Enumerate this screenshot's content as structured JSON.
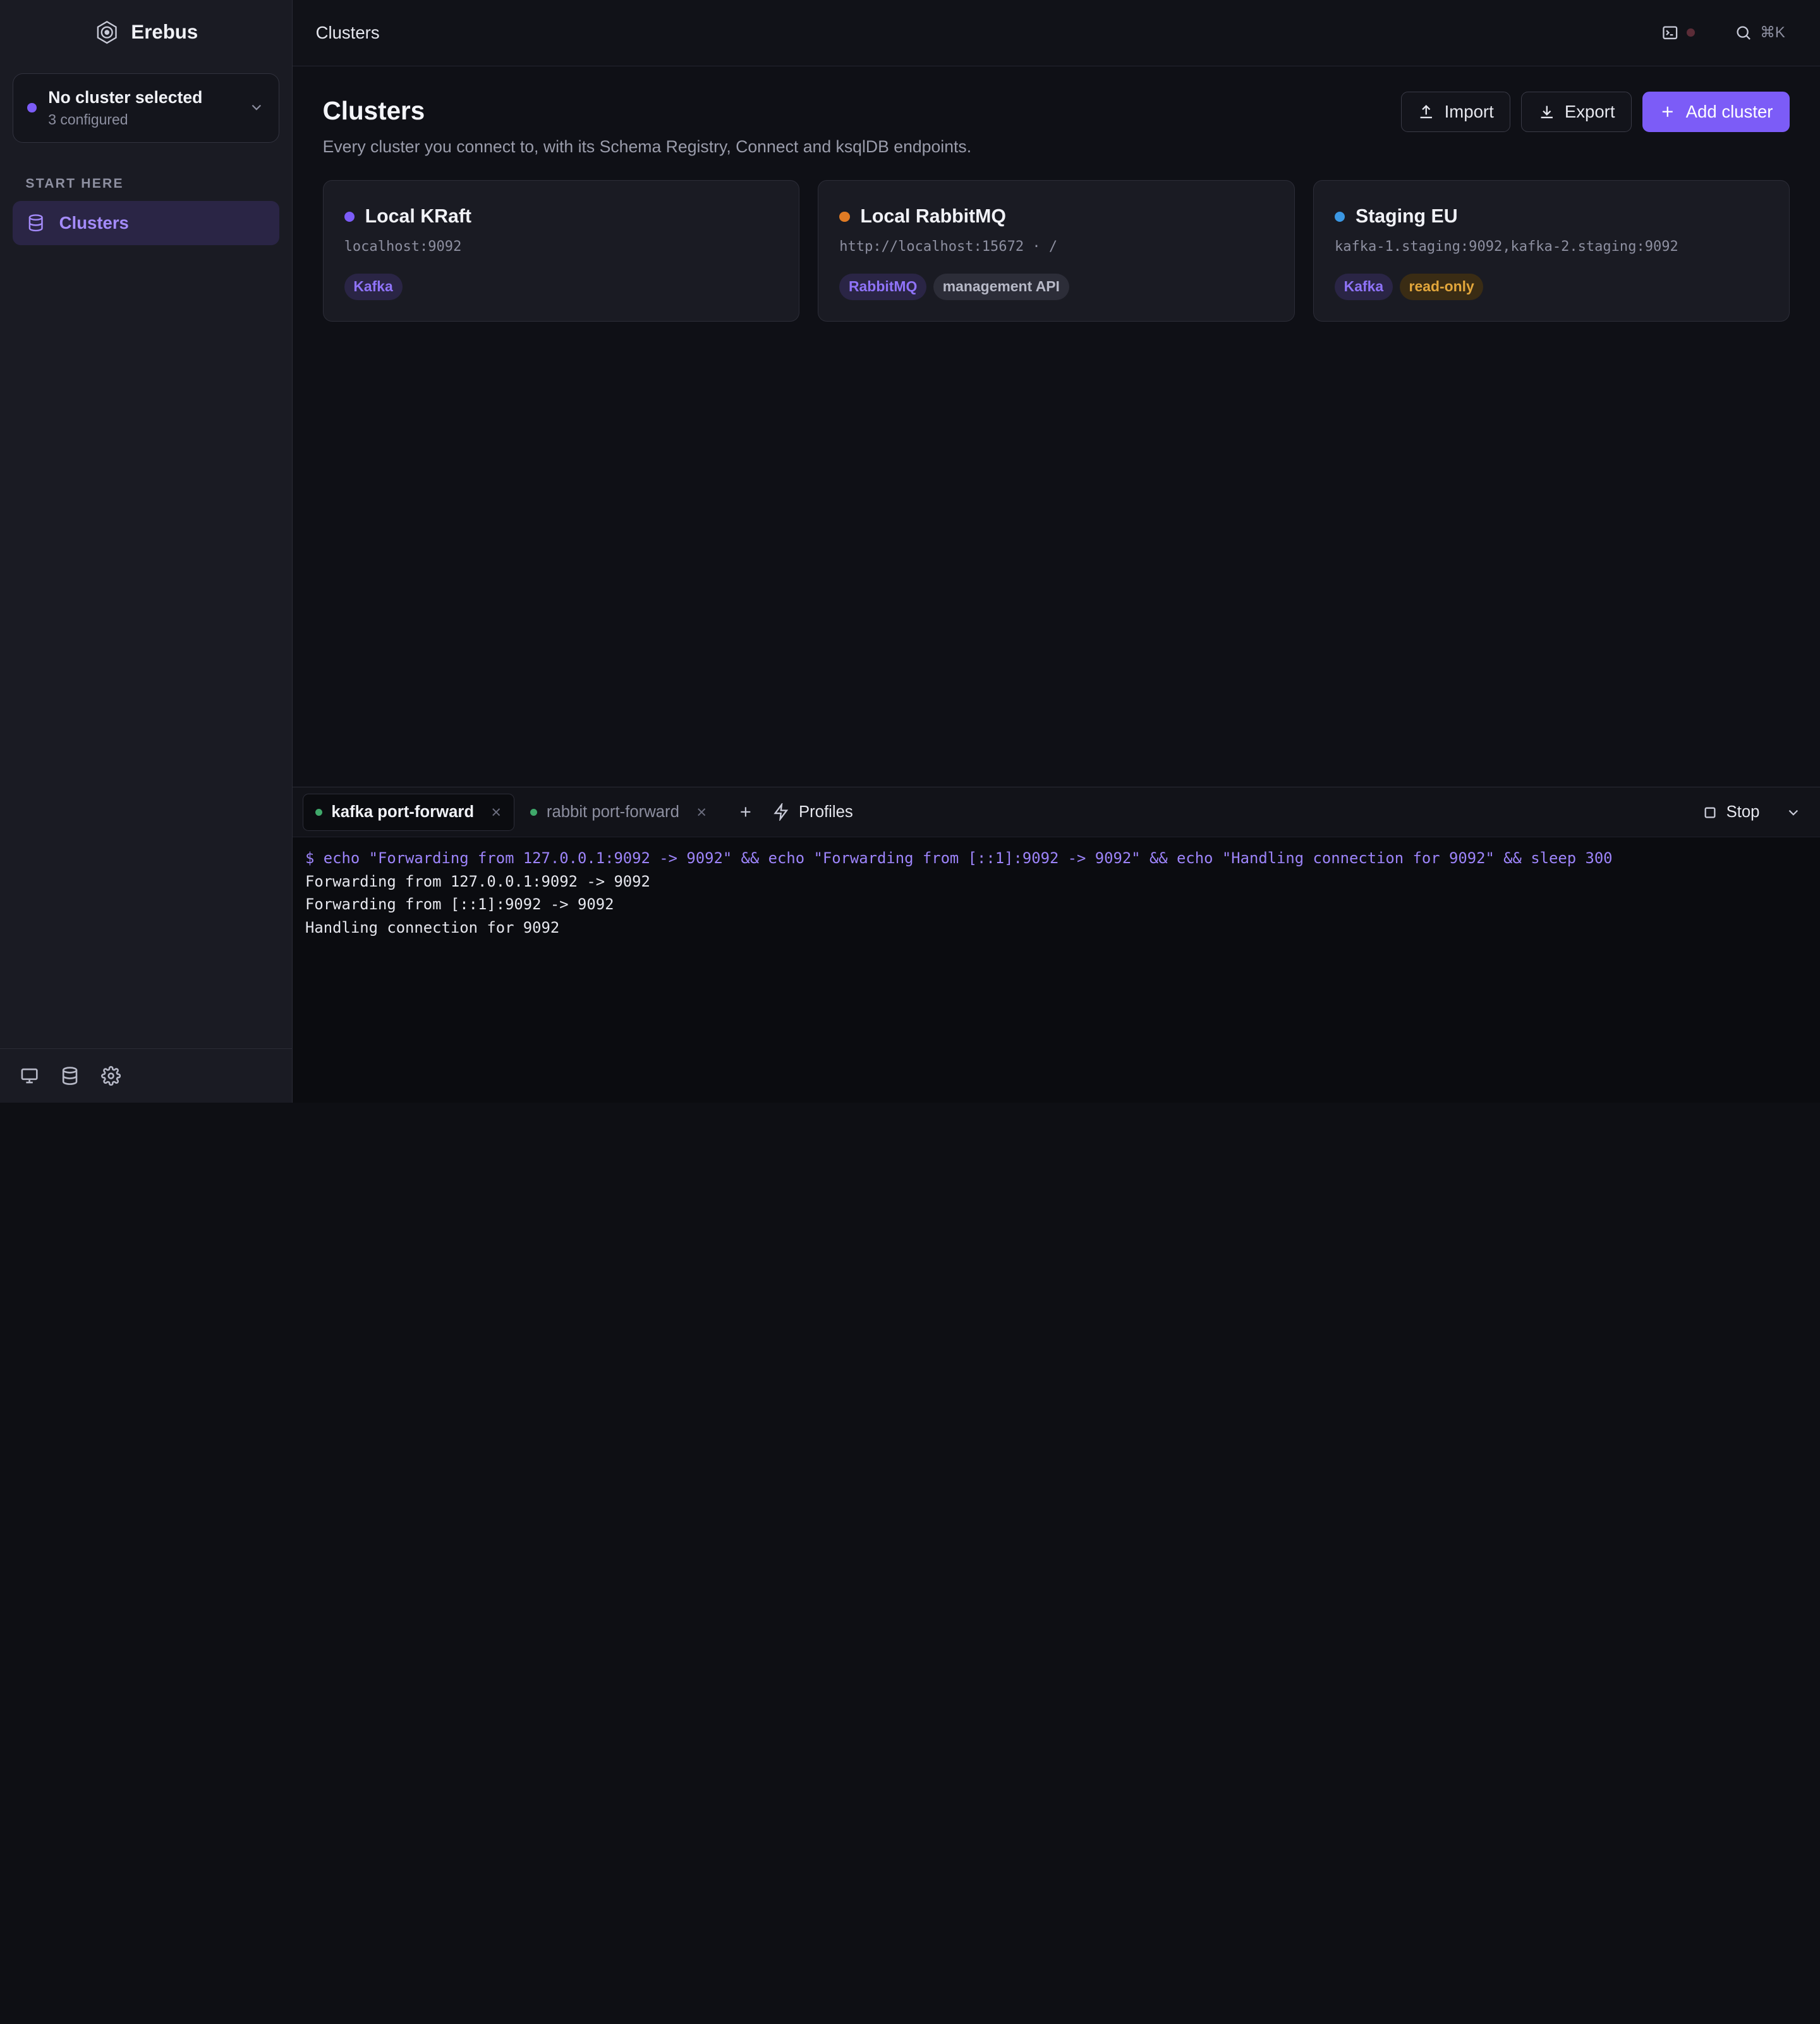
{
  "app": {
    "name": "Erebus"
  },
  "cluster_picker": {
    "title": "No cluster selected",
    "subtitle": "3 configured",
    "dot_color": "#7c5cf7"
  },
  "sidebar": {
    "section_label": "START HERE",
    "items": [
      {
        "label": "Clusters",
        "icon": "database-icon",
        "active": true
      }
    ],
    "footer_icons": [
      "monitor-icon",
      "database-icon",
      "gear-icon"
    ]
  },
  "topbar": {
    "breadcrumb": "Clusters",
    "search_shortcut": "⌘K"
  },
  "page": {
    "title": "Clusters",
    "description": "Every cluster you connect to, with its Schema Registry, Connect and ksqlDB endpoints.",
    "actions": {
      "import": "Import",
      "export": "Export",
      "add": "Add cluster"
    }
  },
  "clusters": [
    {
      "name": "Local KRaft",
      "host": "localhost:9092",
      "color": "#7c5cf7",
      "tags": [
        "Kafka"
      ]
    },
    {
      "name": "Local RabbitMQ",
      "host": "http://localhost:15672 · /",
      "color": "#e07b24",
      "tags": [
        "RabbitMQ",
        "management API"
      ]
    },
    {
      "name": "Staging EU",
      "host": "kafka-1.staging:9092,kafka-2.staging:9092",
      "color": "#3b97e3",
      "tags": [
        "Kafka",
        "read-only"
      ]
    }
  ],
  "terminal": {
    "tabs": [
      {
        "label": "kafka port-forward",
        "active": true
      },
      {
        "label": "rabbit port-forward",
        "active": false
      }
    ],
    "profiles_label": "Profiles",
    "stop_label": "Stop",
    "lines": [
      "$ echo \"Forwarding from 127.0.0.1:9092 -> 9092\" && echo \"Forwarding from [::1]:9092 -> 9092\" && echo \"Handling connection for 9092\" && sleep 300",
      "Forwarding from 127.0.0.1:9092 -> 9092",
      "Forwarding from [::1]:9092 -> 9092",
      "Handling connection for 9092"
    ]
  }
}
